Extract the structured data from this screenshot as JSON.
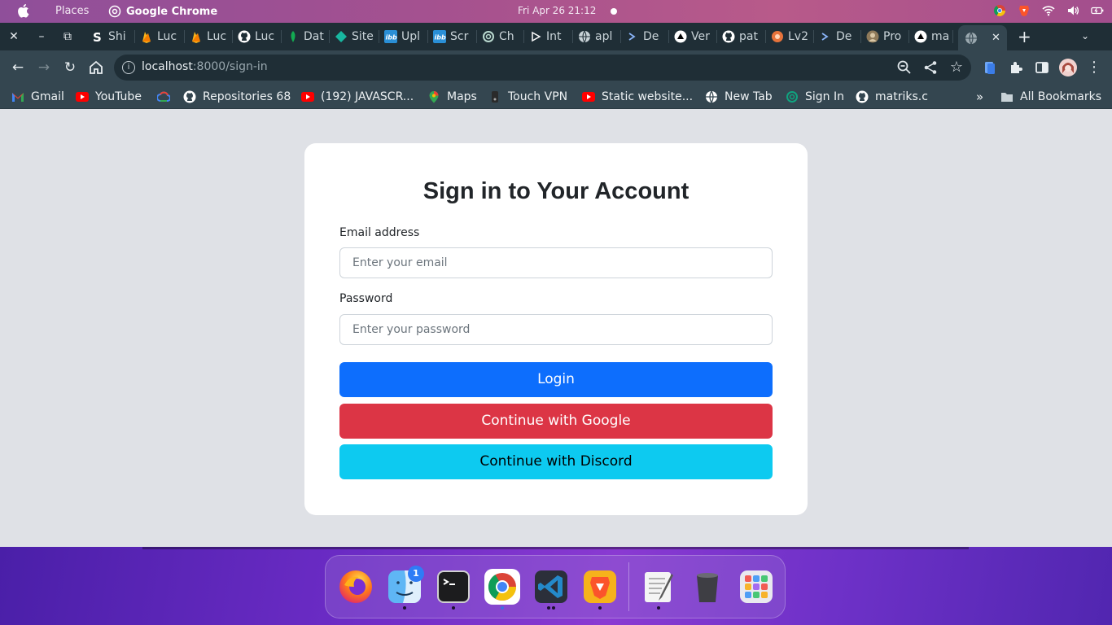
{
  "os_bar": {
    "places": "Places",
    "app_name": "Google Chrome",
    "clock": "Fri Apr 26  21:12"
  },
  "tabs": [
    {
      "label": "Shi",
      "icon": "s-logo-icon",
      "color": "#ffffff"
    },
    {
      "label": "Luc",
      "icon": "firebase-icon",
      "color": "#f6b21b"
    },
    {
      "label": "Luc",
      "icon": "firebase-icon",
      "color": "#f6b21b"
    },
    {
      "label": "Luc",
      "icon": "github-icon",
      "color": "#ffffff"
    },
    {
      "label": "Dat",
      "icon": "mongodb-icon",
      "color": "#13aa52"
    },
    {
      "label": "Site",
      "icon": "diamond-icon",
      "color": "#18b7a0"
    },
    {
      "label": "Upl",
      "icon": "imgbb-icon",
      "color": "#2a8fd6"
    },
    {
      "label": "Scr",
      "icon": "imgbb-icon",
      "color": "#2a8fd6"
    },
    {
      "label": "Ch",
      "icon": "openai-icon",
      "color": "#b9d9cf"
    },
    {
      "label": "Int",
      "icon": "play-icon",
      "color": "#ffffff"
    },
    {
      "label": "apl",
      "icon": "globe-icon",
      "color": "#c9d3d8"
    },
    {
      "label": "De",
      "icon": "terminal-arrow-icon",
      "color": "#8ab4f8"
    },
    {
      "label": "Ver",
      "icon": "vercel-icon",
      "color": "#ffffff"
    },
    {
      "label": "pat",
      "icon": "github-icon",
      "color": "#ffffff"
    },
    {
      "label": "Lv2",
      "icon": "gear-ball-icon",
      "color": "#e6733b"
    },
    {
      "label": "De",
      "icon": "terminal-arrow-icon",
      "color": "#8ab4f8"
    },
    {
      "label": "Pro",
      "icon": "avatar-icon",
      "color": "#8f7a5a"
    },
    {
      "label": "ma",
      "icon": "vercel-icon",
      "color": "#ffffff"
    }
  ],
  "active_tab_icon": "globe-icon",
  "omnibox": {
    "host": "localhost",
    "path": ":8000/sign-in"
  },
  "bookmarks": [
    {
      "label": "Gmail",
      "icon": "gmail-icon"
    },
    {
      "label": "YouTube",
      "icon": "youtube-icon"
    },
    {
      "label": "",
      "icon": "google-cloud-icon"
    },
    {
      "label": "Repositories 68",
      "icon": "github-icon"
    },
    {
      "label": "(192) JAVASCR...",
      "icon": "youtube-icon"
    },
    {
      "label": "Maps",
      "icon": "maps-pin-icon"
    },
    {
      "label": "Touch VPN",
      "icon": "vpn-icon"
    },
    {
      "label": "Static website...",
      "icon": "youtube-icon"
    },
    {
      "label": "New Tab",
      "icon": "globe-icon"
    },
    {
      "label": "Sign In",
      "icon": "openai-icon"
    },
    {
      "label": "matriks.c",
      "icon": "github-icon"
    }
  ],
  "bookmarks_overflow": "»",
  "all_bookmarks": "All Bookmarks",
  "signin": {
    "title": "Sign in to Your Account",
    "email_label": "Email address",
    "email_placeholder": "Enter your email",
    "email_value": "",
    "password_label": "Password",
    "password_placeholder": "Enter your password",
    "password_value": "",
    "login_label": "Login",
    "google_label": "Continue with Google",
    "discord_label": "Continue with Discord"
  },
  "colors": {
    "login": "#0d6efd",
    "google": "#dc3545",
    "discord": "#0dcaf0"
  },
  "dock": {
    "apps": [
      "firefox-icon",
      "finder-icon",
      "terminal-icon",
      "chrome-icon",
      "vscode-icon",
      "brave-icon",
      "text-editor-icon",
      "trash-icon",
      "launchpad-icon"
    ],
    "finder_badge": "1"
  }
}
